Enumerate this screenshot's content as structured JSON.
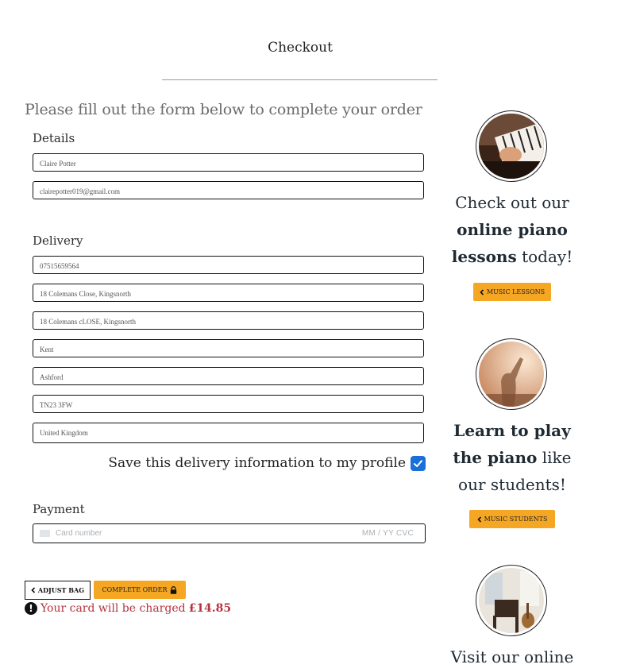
{
  "page": {
    "title": "Checkout",
    "intro": "Please fill out the form below to complete your order"
  },
  "details": {
    "label": "Details",
    "full_name": "Claire Potter",
    "email": "clairepotter019@gmail.com"
  },
  "delivery": {
    "label": "Delivery",
    "phone": "07515659564",
    "street1": "18 Colemans Close, Kingsnorth",
    "street2": "18 Colemans cLOSE, Kingsnorth",
    "county": "Kent",
    "town": "Ashford",
    "postcode": "TN23 3FW",
    "country": "United Kingdom",
    "save_label": "Save this delivery information to my profile",
    "save_checked": true
  },
  "payment": {
    "label": "Payment",
    "card_placeholder": "Card number",
    "expiry_cvc_placeholder": "MM / YY  CVC"
  },
  "actions": {
    "adjust_bag": "ADJUST BAG",
    "complete_order": "COMPLETE ORDER",
    "charge_prefix": "Your card will be charged",
    "charge_amount": "£14.85"
  },
  "sidebar": {
    "promo1": {
      "line1": "Check out our",
      "bold": "online piano",
      "bold2": "lessons",
      "tail": " today!",
      "button": "MUSIC LESSONS"
    },
    "promo2": {
      "bold": "Learn to play",
      "bold2": "the piano",
      "tail": " like",
      "line3": "our students!",
      "button": "MUSIC STUDENTS"
    },
    "promo3": {
      "line1": "Visit our online"
    }
  },
  "colors": {
    "accent": "#f5a623",
    "error": "#b5333d",
    "checkbox": "#1a6fd9"
  }
}
